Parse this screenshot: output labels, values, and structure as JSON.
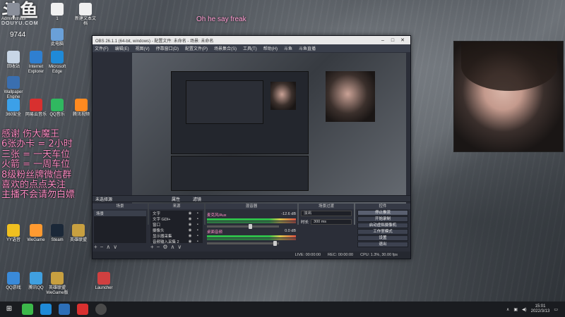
{
  "overlay": {
    "top_text": "Oh he say freak",
    "room_id": "9744",
    "logo_mark": "斗鱼",
    "logo_sub": "DOUYU.COM",
    "promo_lines": [
      "感谢 伤大魔王",
      "6张办卡 = 2小时",
      "三张 = 一天车位",
      "火箭 = 一周车位",
      "8级粉丝牌微信群",
      "喜欢的点点关注",
      "主播不会请勿白嫖"
    ]
  },
  "desktop_icons": [
    {
      "label": "Administrator",
      "color": "#8a8f9a"
    },
    {
      "label": "1",
      "color": "#f0f0f0"
    },
    {
      "label": "新建文本文档",
      "color": "#f0f0f0"
    },
    {
      "label": "此电脑",
      "color": "#6aa0d8"
    },
    {
      "label": "回收站",
      "color": "#c8d6e6"
    },
    {
      "label": "Internet Explorer",
      "color": "#2f7fd0"
    },
    {
      "label": "Microsoft Edge",
      "color": "#1f8ad8"
    },
    {
      "label": "Wallpaper Engine",
      "color": "#3a6fb0"
    },
    {
      "label": "360安全",
      "color": "#3ca0e8"
    },
    {
      "label": "网易云音乐",
      "color": "#d8302f"
    },
    {
      "label": "QQ音乐",
      "color": "#30b860"
    },
    {
      "label": "腾讯视频",
      "color": "#ff8a20"
    },
    {
      "label": "YY语音",
      "color": "#f0c020"
    },
    {
      "label": "WeGame",
      "color": "#ff9a30"
    },
    {
      "label": "Steam",
      "color": "#1b2838"
    },
    {
      "label": "英雄联盟",
      "color": "#c8a040"
    },
    {
      "label": "QQ游戏",
      "color": "#3a8ad8"
    },
    {
      "label": "腾讯QQ",
      "color": "#40a0e0"
    },
    {
      "label": "英雄联盟WeGame版",
      "color": "#c8a040"
    },
    {
      "label": "Launcher",
      "color": "#d04040"
    }
  ],
  "obs": {
    "title": "OBS 26.1.1 (64-bit, windows) - 配置文件: 未命名 - 场景: 未命名",
    "menu": [
      "文件(F)",
      "编辑(E)",
      "视图(V)",
      "停靠窗口(D)",
      "配置文件(P)",
      "场景集合(S)",
      "工具(T)",
      "帮助(H)",
      "斗鱼",
      "斗鱼直播"
    ],
    "tabs": [
      "未选择源",
      "属性",
      "滤镜"
    ],
    "docks": {
      "scenes": {
        "title": "场景",
        "items": [
          "场景"
        ]
      },
      "sources": {
        "title": "来源",
        "items": [
          "文字",
          "文字 GDI+",
          "窗口",
          "摄像头",
          "显示器采集",
          "音频输入采集 2"
        ]
      },
      "mixer": {
        "title": "混音器",
        "tracks": [
          {
            "name": "麦克风/Aux",
            "db": "-12.6 dB"
          },
          {
            "name": "桌面音频",
            "db": "0.0 dB"
          }
        ]
      },
      "transitions": {
        "title": "场景过渡",
        "type": "淡出",
        "duration_label": "时长",
        "duration": "300 ms"
      },
      "controls": {
        "title": "控件",
        "buttons": [
          "停止推流",
          "开始录制",
          "启动虚拟摄像机",
          "工作室模式",
          "设置",
          "退出"
        ]
      }
    },
    "status": {
      "live": "LIVE: 00:00:00",
      "rec": "REC: 00:00:00",
      "cpu": "CPU: 1.3%, 30.00 fps"
    }
  },
  "taskbar": {
    "time": "15:01",
    "date": "2022/3/13"
  }
}
